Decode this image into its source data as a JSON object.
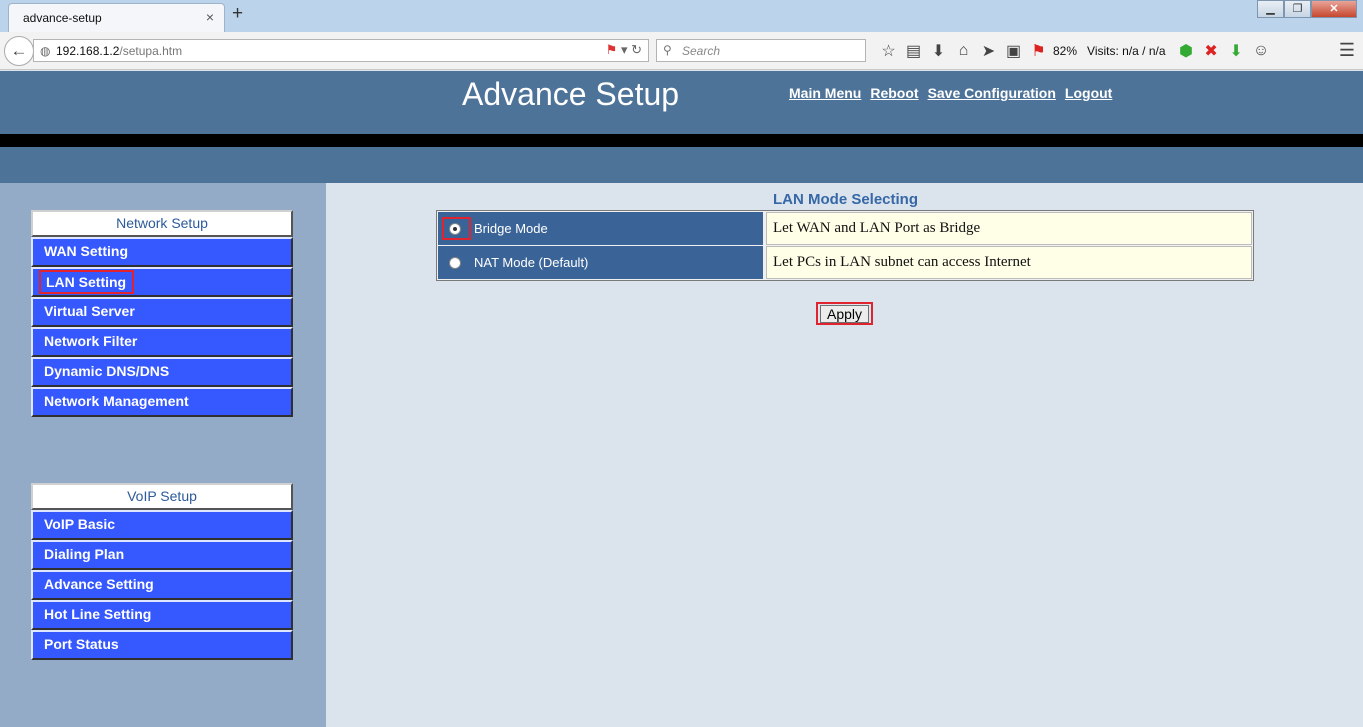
{
  "browser": {
    "tab_title": "advance-setup",
    "tab_close": "×",
    "new_tab": "+",
    "window_buttons": [
      "▁",
      "❐",
      "✕"
    ],
    "back_glyph": "←",
    "url_host": "192.168.1.2",
    "url_path": "/setupa.htm",
    "search_placeholder": "Search",
    "battery_percent": "82%",
    "visits_text": "Visits: n/a / n/a",
    "hamburger": "☰"
  },
  "header": {
    "title": "Advance Setup",
    "links": [
      "Main Menu",
      "Reboot",
      "Save Configuration",
      "Logout"
    ]
  },
  "sidebar": {
    "network": {
      "title": "Network Setup",
      "items": [
        "WAN Setting",
        "LAN Setting",
        "Virtual Server",
        "Network Filter",
        "Dynamic DNS/DNS",
        "Network Management"
      ]
    },
    "voip": {
      "title": "VoIP Setup",
      "items": [
        "VoIP Basic",
        "Dialing Plan",
        "Advance Setting",
        "Hot Line Setting",
        "Port Status"
      ]
    }
  },
  "main": {
    "title": "LAN Mode Selecting",
    "modes": [
      {
        "label": "Bridge Mode",
        "description": "Let WAN and LAN Port as Bridge",
        "selected": true
      },
      {
        "label": "NAT Mode (Default)",
        "description": "Let PCs in LAN subnet can access Internet",
        "selected": false
      }
    ],
    "apply_label": "Apply"
  },
  "colors": {
    "header_bg": "#4e7399",
    "sidebar_bg": "#93abc6",
    "menu_item_bg": "#3558ff",
    "content_bg": "#dbe3ed",
    "highlight_red": "#e0232f"
  }
}
